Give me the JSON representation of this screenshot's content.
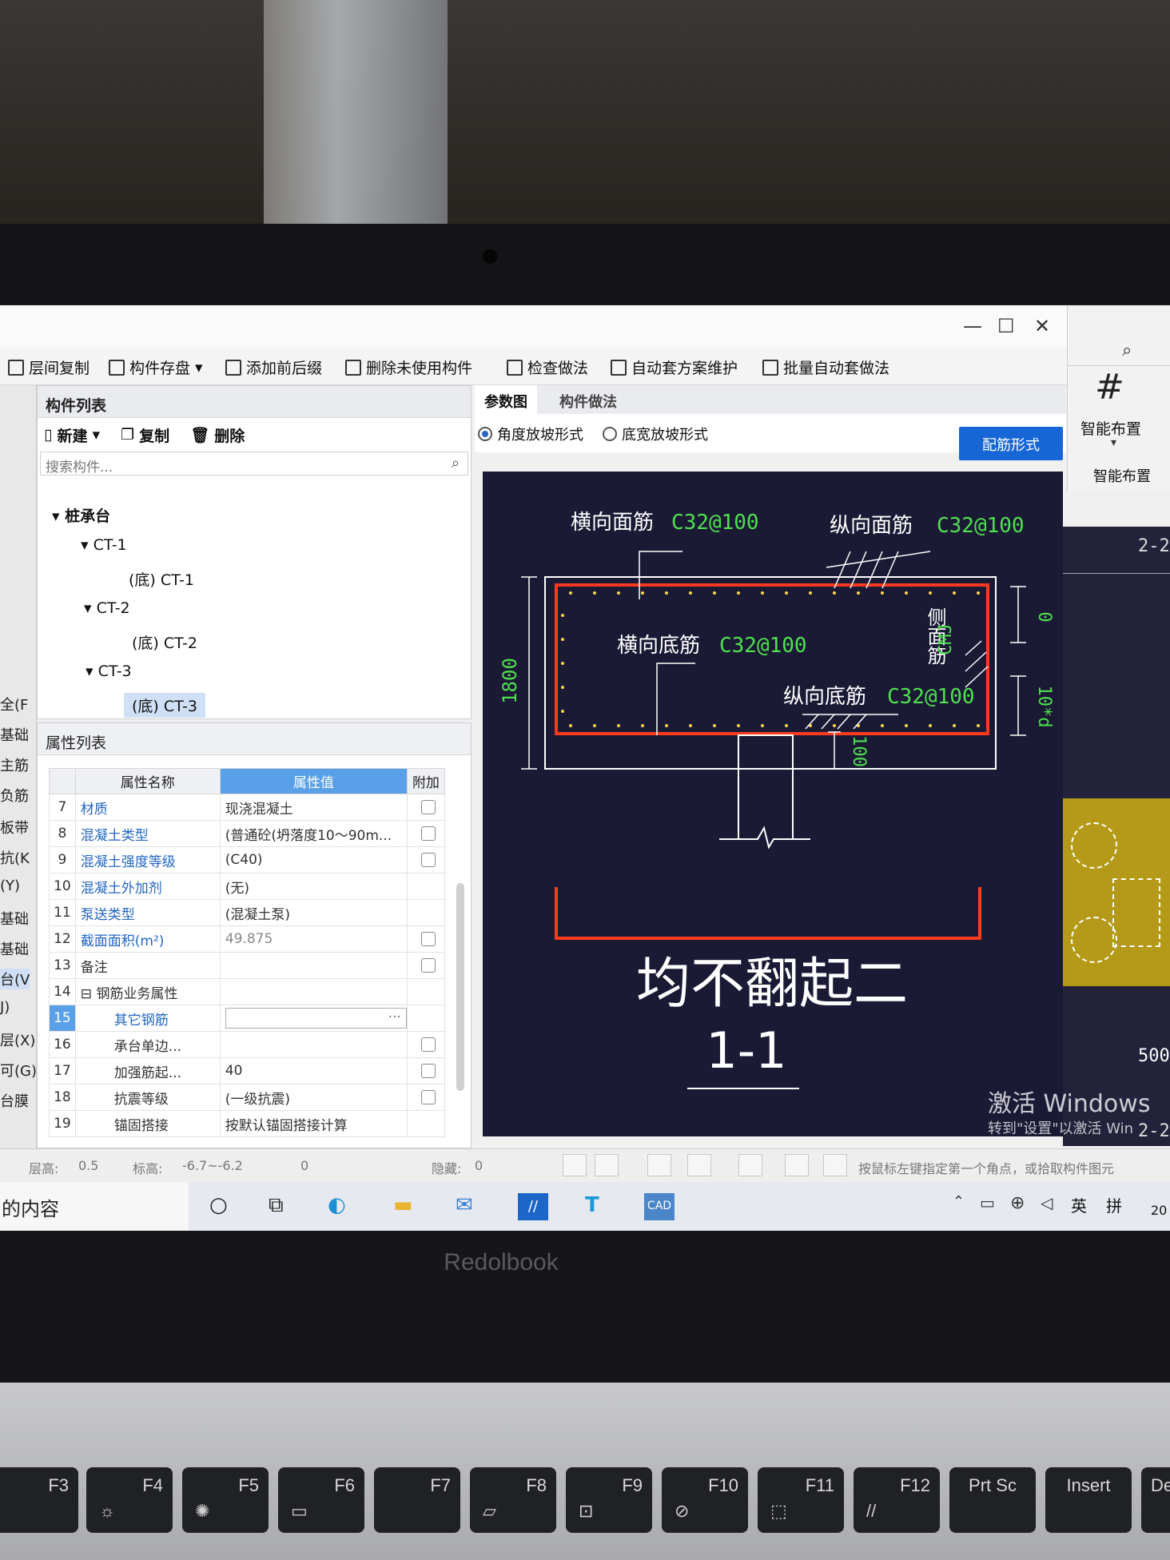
{
  "window": {
    "minimize": "—",
    "maximize": "☐",
    "close": "✕"
  },
  "toolbar": [
    {
      "label": "层间复制"
    },
    {
      "label": "构件存盘",
      "dropdown": "▾"
    },
    {
      "label": "添加前后缀"
    },
    {
      "label": "删除未使用构件"
    },
    {
      "label": "检查做法"
    },
    {
      "label": "自动套方案维护"
    },
    {
      "label": "批量自动套做法"
    }
  ],
  "left_edge": [
    "全(F",
    "基础",
    "主筋",
    "负筋",
    "板带",
    "抗(K",
    "(Y)",
    "基础",
    "基础",
    "台(V",
    "J)",
    "层(X)",
    "可(G)",
    "台膜"
  ],
  "component_list": {
    "title": "构件列表",
    "new_label": "新建",
    "new_dropdown": "▾",
    "copy_label": "复制",
    "delete_label": "删除",
    "search_placeholder": "搜索构件...",
    "tree": [
      {
        "label": "▾ 桩承台",
        "level": 0
      },
      {
        "label": "▾ CT-1",
        "level": 1
      },
      {
        "label": "(底) CT-1",
        "level": 2
      },
      {
        "label": "▾ CT-2",
        "level": 1
      },
      {
        "label": "(底) CT-2",
        "level": 2
      },
      {
        "label": "▾ CT-3",
        "level": 1
      },
      {
        "label": "(底) CT-3",
        "level": 2,
        "selected": true
      }
    ]
  },
  "property_list": {
    "title": "属性列表",
    "headers": {
      "name": "属性名称",
      "value": "属性值",
      "extra": "附加"
    },
    "rows": [
      {
        "num": "7",
        "name": "材质",
        "value": "现浇混凝土"
      },
      {
        "num": "8",
        "name": "混凝土类型",
        "value": "(普通砼(坍落度10～90m..."
      },
      {
        "num": "9",
        "name": "混凝土强度等级",
        "value": "(C40)"
      },
      {
        "num": "10",
        "name": "混凝土外加剂",
        "value": "(无)"
      },
      {
        "num": "11",
        "name": "泵送类型",
        "value": "(混凝土泵)"
      },
      {
        "num": "12",
        "name": "截面面积(m²)",
        "value": "49.875"
      },
      {
        "num": "13",
        "name": "备注",
        "value": ""
      },
      {
        "num": "14",
        "name": "⊟ 钢筋业务属性",
        "value": ""
      },
      {
        "num": "15",
        "name": "其它钢筋",
        "value": ""
      },
      {
        "num": "16",
        "name": "承台单边...",
        "value": ""
      },
      {
        "num": "17",
        "name": "加强筋起...",
        "value": "40"
      },
      {
        "num": "18",
        "name": "抗震等级",
        "value": "(一级抗震)"
      },
      {
        "num": "19",
        "name": "锚固搭接",
        "value": "按默认锚固搭接计算"
      }
    ],
    "ellipsis": "···"
  },
  "tabs": [
    {
      "label": "参数图",
      "active": true
    },
    {
      "label": "构件做法",
      "active": false
    }
  ],
  "slope_options": [
    {
      "label": "角度放坡形式",
      "selected": true
    },
    {
      "label": "底宽放坡形式",
      "selected": false
    }
  ],
  "rebar_button": "配筋形式",
  "drawing": {
    "top_transverse": "横向面筋",
    "top_transverse_spec": "C32@100",
    "top_longitudinal": "纵向面筋",
    "top_longitudinal_spec": "C32@100",
    "bottom_transverse": "横向底筋",
    "bottom_transverse_spec": "C32@100",
    "bottom_longitudinal": "纵向底筋",
    "bottom_longitudinal_spec": "C32@100",
    "side_bar": "侧面筋",
    "side_bar_spec": "CMJ",
    "height": "1800",
    "cover_top": "0",
    "anchor": "10*d",
    "embed": "100",
    "caption": "均不翻起二",
    "section": "1-1"
  },
  "watermark": {
    "line1": "激活 Windows",
    "line2": "转到\"设置\"以激活 Win"
  },
  "smart_panel": {
    "label": "智能布置",
    "dropdown": "▾",
    "sub_label": "智能布置",
    "search_icon": "⌕",
    "canvas_label": "2-2",
    "canvas_dim": "500",
    "canvas_label2": "2-2"
  },
  "status_bar": {
    "floor_height_label": "层高:",
    "floor_height": "0.5",
    "elevation_label": "标高:",
    "elevation": "-6.7~-6.2",
    "count": "0",
    "hidden_label": "隐藏:",
    "hidden": "0",
    "hint": "按鼠标左键指定第一个角点，或拾取构件图元"
  },
  "taskbar": {
    "search_text": "的内容",
    "ime_lang": "英",
    "ime_mode": "拼",
    "year": "20"
  },
  "laptop": {
    "brand": "Redolbook",
    "keys": [
      "F3",
      "F4",
      "F5",
      "F6",
      "F7",
      "F8",
      "F9",
      "F10",
      "F11",
      "F12",
      "Prt Sc",
      "Insert",
      "Dele"
    ]
  },
  "colors": {
    "accent": "#1766d6",
    "drawing_bg": "#1b1a35",
    "rebar_red": "#ff3b1f",
    "spec_green": "#4fe04f"
  }
}
